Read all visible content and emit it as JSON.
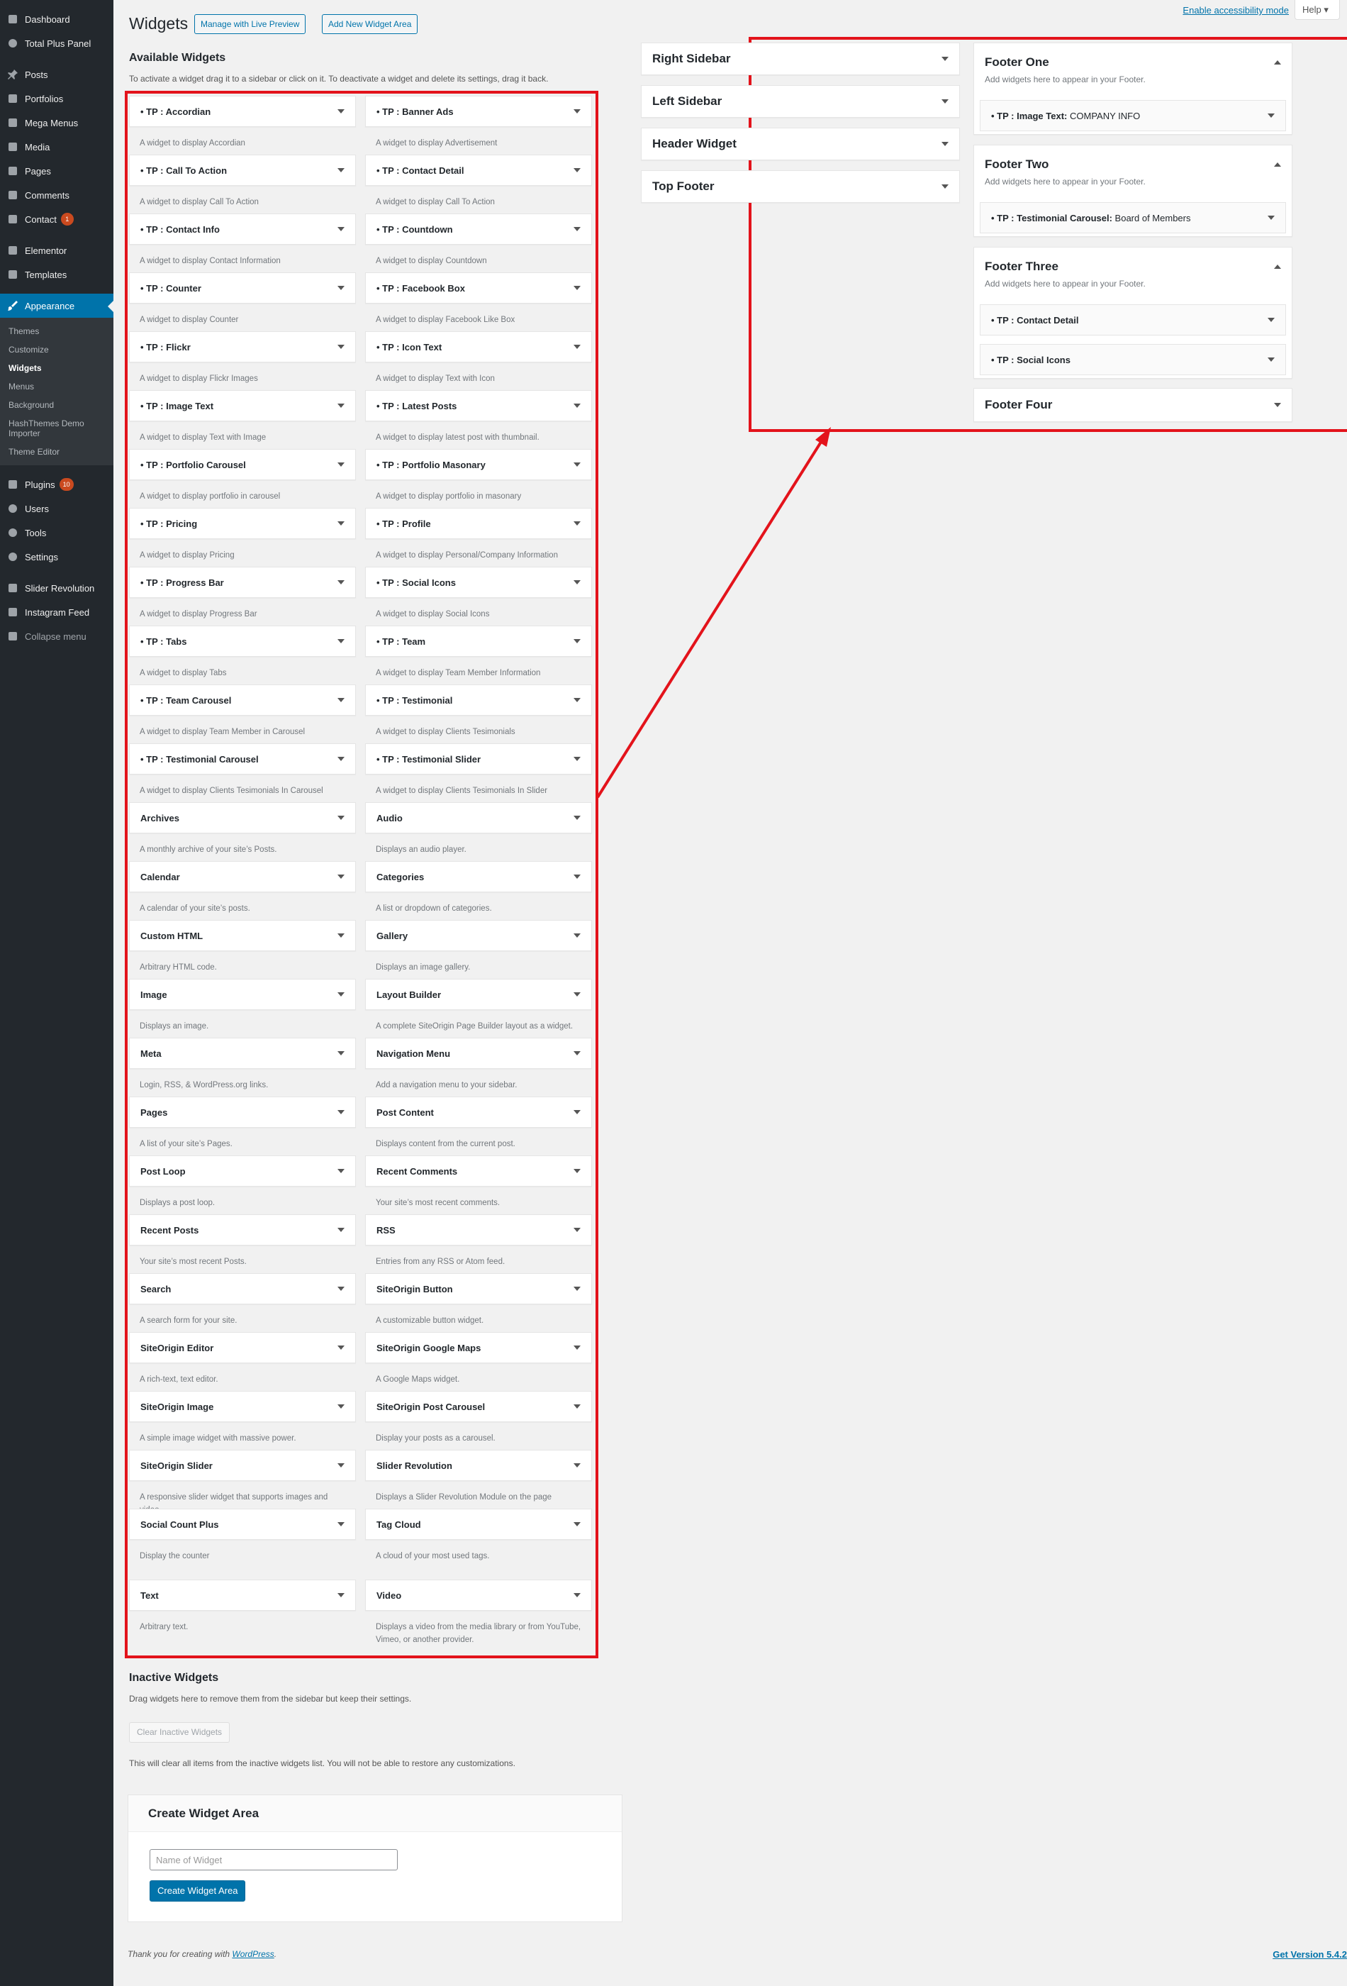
{
  "colors": {
    "accent": "#0073aa",
    "highlight": "#e3131b",
    "badge": "#ca4a1f",
    "sidebar_bg": "#23282d"
  },
  "sidebar": {
    "items": [
      {
        "label": "Dashboard",
        "icon": "dashboard-icon",
        "badge": ""
      },
      {
        "label": "Total Plus Panel",
        "icon": "gear-icon",
        "badge": ""
      },
      {
        "label": "Posts",
        "icon": "pin-icon",
        "badge": ""
      },
      {
        "label": "Portfolios",
        "icon": "portfolio-icon",
        "badge": ""
      },
      {
        "label": "Mega Menus",
        "icon": "menus-icon",
        "badge": ""
      },
      {
        "label": "Media",
        "icon": "media-icon",
        "badge": ""
      },
      {
        "label": "Pages",
        "icon": "pages-icon",
        "badge": ""
      },
      {
        "label": "Comments",
        "icon": "comments-icon",
        "badge": ""
      },
      {
        "label": "Contact",
        "icon": "mail-icon",
        "badge": "1"
      },
      {
        "label": "Elementor",
        "icon": "elementor-icon",
        "badge": ""
      },
      {
        "label": "Templates",
        "icon": "folder-icon",
        "badge": ""
      },
      {
        "label": "Appearance",
        "icon": "paintbrush-icon",
        "badge": ""
      },
      {
        "label": "Plugins",
        "icon": "plugins-icon",
        "badge": "10"
      },
      {
        "label": "Users",
        "icon": "users-icon",
        "badge": ""
      },
      {
        "label": "Tools",
        "icon": "tools-icon",
        "badge": ""
      },
      {
        "label": "Settings",
        "icon": "settings-icon",
        "badge": ""
      },
      {
        "label": "Slider Revolution",
        "icon": "slider-icon",
        "badge": ""
      },
      {
        "label": "Instagram Feed",
        "icon": "instagram-icon",
        "badge": ""
      },
      {
        "label": "Collapse menu",
        "icon": "collapse-icon",
        "badge": ""
      }
    ],
    "submenu": [
      "Themes",
      "Customize",
      "Widgets",
      "Menus",
      "Background",
      "HashThemes Demo Importer",
      "Theme Editor"
    ]
  },
  "header": {
    "title": "Widgets",
    "live_preview": "Manage with Live Preview",
    "add_area": "Add New Widget Area",
    "accessibility": "Enable accessibility mode",
    "help": "Help"
  },
  "available": {
    "title": "Available Widgets",
    "desc": "To activate a widget drag it to a sidebar or click on it. To deactivate a widget and delete its settings, drag it back.",
    "widgets": [
      {
        "name": "• TP : Accordian",
        "desc": "A widget to display Accordian"
      },
      {
        "name": "• TP : Banner Ads",
        "desc": "A widget to display Advertisement"
      },
      {
        "name": "• TP : Call To Action",
        "desc": "A widget to display Call To Action"
      },
      {
        "name": "• TP : Contact Detail",
        "desc": "A widget to display Call To Action"
      },
      {
        "name": "• TP : Contact Info",
        "desc": "A widget to display Contact Information"
      },
      {
        "name": "• TP : Countdown",
        "desc": "A widget to display Countdown"
      },
      {
        "name": "• TP : Counter",
        "desc": "A widget to display Counter"
      },
      {
        "name": "• TP : Facebook Box",
        "desc": "A widget to display Facebook Like Box"
      },
      {
        "name": "• TP : Flickr",
        "desc": "A widget to display Flickr Images"
      },
      {
        "name": "• TP : Icon Text",
        "desc": "A widget to display Text with Icon"
      },
      {
        "name": "• TP : Image Text",
        "desc": "A widget to display Text with Image"
      },
      {
        "name": "• TP : Latest Posts",
        "desc": "A widget to display latest post with thumbnail."
      },
      {
        "name": "• TP : Portfolio Carousel",
        "desc": "A widget to display portfolio in carousel"
      },
      {
        "name": "• TP : Portfolio Masonary",
        "desc": "A widget to display portfolio in masonary"
      },
      {
        "name": "• TP : Pricing",
        "desc": "A widget to display Pricing"
      },
      {
        "name": "• TP : Profile",
        "desc": "A widget to display Personal/Company Information"
      },
      {
        "name": "• TP : Progress Bar",
        "desc": "A widget to display Progress Bar"
      },
      {
        "name": "• TP : Social Icons",
        "desc": "A widget to display Social Icons"
      },
      {
        "name": "• TP : Tabs",
        "desc": "A widget to display Tabs"
      },
      {
        "name": "• TP : Team",
        "desc": "A widget to display Team Member Information"
      },
      {
        "name": "• TP : Team Carousel",
        "desc": "A widget to display Team Member in Carousel"
      },
      {
        "name": "• TP : Testimonial",
        "desc": "A widget to display Clients Tesimonials"
      },
      {
        "name": "• TP : Testimonial Carousel",
        "desc": "A widget to display Clients Tesimonials In Carousel"
      },
      {
        "name": "• TP : Testimonial Slider",
        "desc": "A widget to display Clients Tesimonials In Slider"
      },
      {
        "name": "Archives",
        "desc": "A monthly archive of your site’s Posts."
      },
      {
        "name": "Audio",
        "desc": "Displays an audio player."
      },
      {
        "name": "Calendar",
        "desc": "A calendar of your site’s posts."
      },
      {
        "name": "Categories",
        "desc": "A list or dropdown of categories."
      },
      {
        "name": "Custom HTML",
        "desc": "Arbitrary HTML code."
      },
      {
        "name": "Gallery",
        "desc": "Displays an image gallery."
      },
      {
        "name": "Image",
        "desc": "Displays an image."
      },
      {
        "name": "Layout Builder",
        "desc": "A complete SiteOrigin Page Builder layout as a widget."
      },
      {
        "name": "Meta",
        "desc": "Login, RSS, & WordPress.org links."
      },
      {
        "name": "Navigation Menu",
        "desc": "Add a navigation menu to your sidebar."
      },
      {
        "name": "Pages",
        "desc": "A list of your site’s Pages."
      },
      {
        "name": "Post Content",
        "desc": "Displays content from the current post."
      },
      {
        "name": "Post Loop",
        "desc": "Displays a post loop."
      },
      {
        "name": "Recent Comments",
        "desc": "Your site’s most recent comments."
      },
      {
        "name": "Recent Posts",
        "desc": "Your site’s most recent Posts."
      },
      {
        "name": "RSS",
        "desc": "Entries from any RSS or Atom feed."
      },
      {
        "name": "Search",
        "desc": "A search form for your site."
      },
      {
        "name": "SiteOrigin Button",
        "desc": "A customizable button widget."
      },
      {
        "name": "SiteOrigin Editor",
        "desc": "A rich-text, text editor."
      },
      {
        "name": "SiteOrigin Google Maps",
        "desc": "A Google Maps widget."
      },
      {
        "name": "SiteOrigin Image",
        "desc": "A simple image widget with massive power."
      },
      {
        "name": "SiteOrigin Post Carousel",
        "desc": "Display your posts as a carousel."
      },
      {
        "name": "SiteOrigin Slider",
        "desc": "A responsive slider widget that supports images and video."
      },
      {
        "name": "Slider Revolution",
        "desc": "Displays a Slider Revolution Module on the page"
      },
      {
        "name": "Social Count Plus",
        "desc": "Display the counter"
      },
      {
        "name": "Tag Cloud",
        "desc": "A cloud of your most used tags."
      },
      {
        "name": "Text",
        "desc": "Arbitrary text."
      },
      {
        "name": "Video",
        "desc": "Displays a video from the media library or from YouTube, Vimeo, or another provider."
      }
    ]
  },
  "sidebars": {
    "left_col": [
      {
        "name": "Right Sidebar"
      },
      {
        "name": "Left Sidebar"
      },
      {
        "name": "Header Widget"
      },
      {
        "name": "Top Footer"
      }
    ],
    "right_col": [
      {
        "name": "Footer One",
        "desc": "Add widgets here to appear in your Footer.",
        "open": true,
        "widgets": [
          {
            "name": "• TP : Image Text:",
            "title": " COMPANY INFO"
          }
        ]
      },
      {
        "name": "Footer Two",
        "desc": "Add widgets here to appear in your Footer.",
        "open": true,
        "widgets": [
          {
            "name": "• TP : Testimonial Carousel:",
            "title": " Board of Members"
          }
        ]
      },
      {
        "name": "Footer Three",
        "desc": "Add widgets here to appear in your Footer.",
        "open": true,
        "widgets": [
          {
            "name": "• TP : Contact Detail",
            "title": ""
          },
          {
            "name": "• TP : Social Icons",
            "title": ""
          }
        ]
      },
      {
        "name": "Footer Four",
        "desc": "",
        "open": false,
        "widgets": []
      }
    ]
  },
  "inactive": {
    "title": "Inactive Widgets",
    "desc": "Drag widgets here to remove them from the sidebar but keep their settings.",
    "clear_btn": "Clear Inactive Widgets",
    "note": "This will clear all items from the inactive widgets list. You will not be able to restore any customizations."
  },
  "create": {
    "title": "Create Widget Area",
    "placeholder": "Name of Widget",
    "button": "Create Widget Area"
  },
  "footer": {
    "thanks_prefix": "Thank you for creating with ",
    "thanks_link": "WordPress",
    "thanks_suffix": ".",
    "version": "Get Version 5.4.2"
  }
}
